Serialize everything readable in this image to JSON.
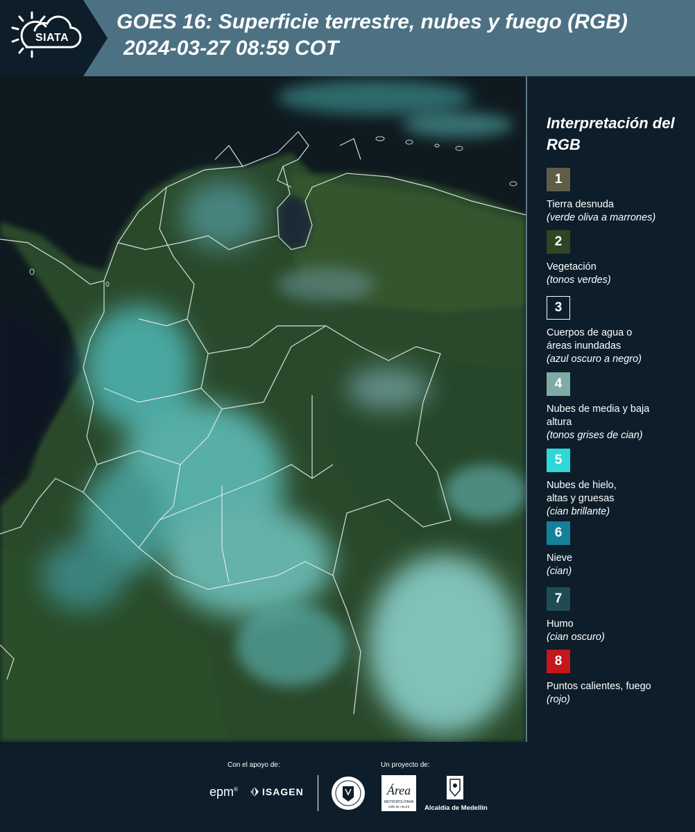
{
  "header": {
    "logo_text": "SIATA",
    "title": "GOES 16: Superficie terrestre, nubes y fuego (RGB)",
    "subtitle": "2024-03-27 08:59 COT"
  },
  "legend": {
    "title": "Interpretación del RGB",
    "items": [
      {
        "number": "1",
        "name": "Tierra desnuda",
        "desc": "(verde oliva a marrones)",
        "color": "#5f5d47"
      },
      {
        "number": "2",
        "name": "Vegetación",
        "desc": "(tonos verdes)",
        "color": "#2f4524"
      },
      {
        "number": "3",
        "name": "Cuerpos de agua o áreas inundadas",
        "desc": "(azul oscuro a negro)",
        "color": "#0d1e2a"
      },
      {
        "number": "4",
        "name": "Nubes de media y baja altura",
        "desc": "(tonos grises de cian)",
        "color": "#7faaa6"
      },
      {
        "number": "5",
        "name": "Nubes de hielo, altas y gruesas",
        "desc": "(cian brillante)",
        "color": "#2fd8d8"
      },
      {
        "number": "6",
        "name": "Nieve",
        "desc": "(cian)",
        "color": "#15809a"
      },
      {
        "number": "7",
        "name": "Humo",
        "desc": "(cian oscuro)",
        "color": "#1f4c52"
      },
      {
        "number": "8",
        "name": "Puntos calientes, fuego",
        "desc": "(rojo)",
        "color": "#c4181c"
      }
    ]
  },
  "footer": {
    "support_label": "Con el apoyo de:",
    "project_label": "Un proyecto de:",
    "epm": "epm",
    "isagen": "ISAGEN",
    "alcaldia": "Alcaldía de Medellín",
    "area_logo_text": "Área METROPOLITANA Valle de Aburrá"
  }
}
